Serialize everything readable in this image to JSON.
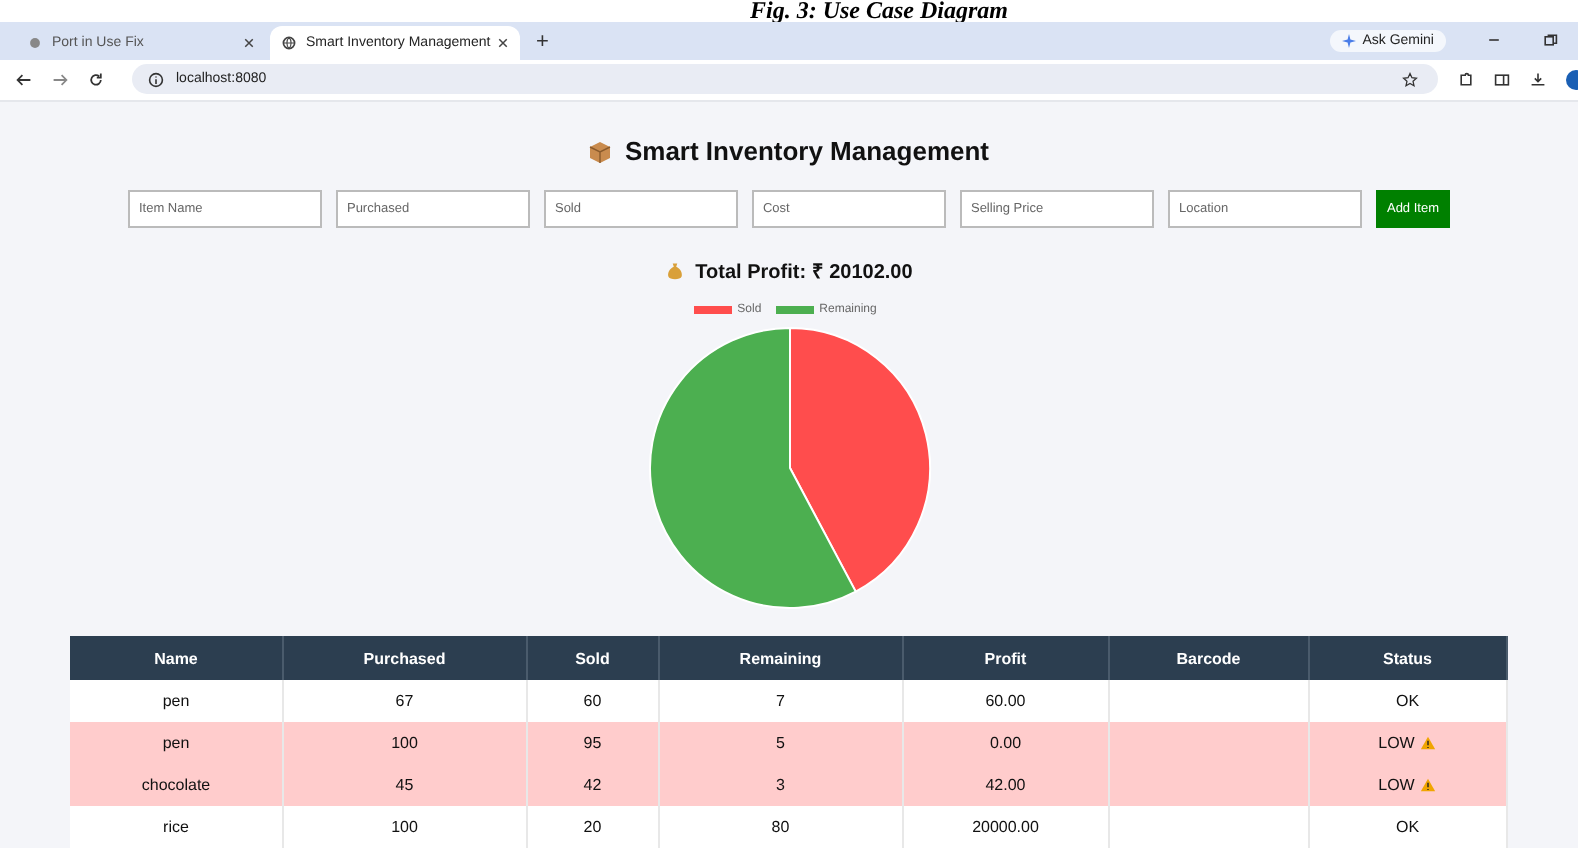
{
  "caption": "Fig. 3: Use Case Diagram",
  "browser": {
    "tabs": [
      {
        "title": "Port in Use Fix",
        "selected": false
      },
      {
        "title": "Smart Inventory Management",
        "selected": true
      }
    ],
    "new_tab": "+",
    "ask_button": "Ask Gemini",
    "address": "localhost:8080"
  },
  "app": {
    "title": "Smart Inventory Management",
    "fields": [
      {
        "placeholder": "Item Name"
      },
      {
        "placeholder": "Purchased"
      },
      {
        "placeholder": "Sold"
      },
      {
        "placeholder": "Cost"
      },
      {
        "placeholder": "Selling Price"
      },
      {
        "placeholder": "Location"
      }
    ],
    "add_button": "Add Item",
    "total_profit": "Total Profit: ₹ 20102.00",
    "legend": [
      {
        "label": "Sold",
        "color": "#ff4d4d"
      },
      {
        "label": "Remaining",
        "color": "#4caf50"
      }
    ],
    "table": {
      "columns": [
        "Name",
        "Purchased",
        "Sold",
        "Remaining",
        "Profit",
        "Barcode",
        "Status"
      ],
      "rows": [
        {
          "cells": [
            "pen",
            "67",
            "60",
            "7",
            "60.00",
            ""
          ],
          "status": "OK",
          "low": false
        },
        {
          "cells": [
            "pen",
            "100",
            "95",
            "5",
            "0.00",
            ""
          ],
          "status": "LOW",
          "low": true
        },
        {
          "cells": [
            "chocolate",
            "45",
            "42",
            "3",
            "42.00",
            ""
          ],
          "status": "LOW",
          "low": true
        },
        {
          "cells": [
            "rice",
            "100",
            "20",
            "80",
            "20000.00",
            ""
          ],
          "status": "OK",
          "low": false
        }
      ]
    }
  }
}
